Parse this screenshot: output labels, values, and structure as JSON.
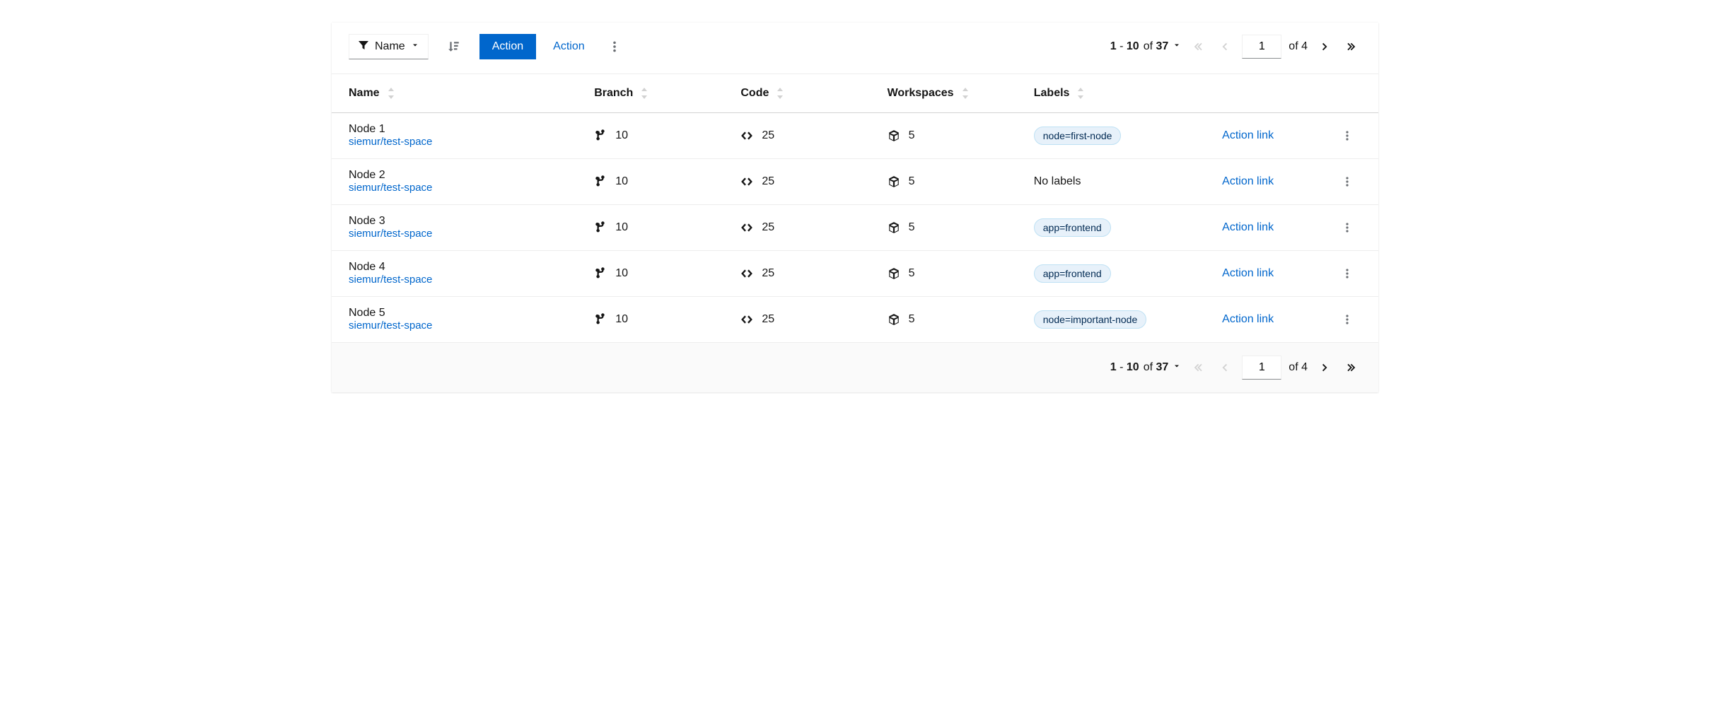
{
  "toolbar": {
    "filter_label": "Name",
    "primary_action": "Action",
    "secondary_action": "Action"
  },
  "pagination": {
    "range_start": "1",
    "range_end": "10",
    "total_items": "37",
    "of_label": "of",
    "page_value": "1",
    "total_pages": "4",
    "dash": " - "
  },
  "columns": {
    "name": "Name",
    "branch": "Branch",
    "code": "Code",
    "workspaces": "Workspaces",
    "labels": "Labels"
  },
  "table": {
    "action_link_label": "Action link",
    "no_labels_text": "No labels",
    "rows": [
      {
        "name": "Node 1",
        "sub": "siemur/test-space",
        "branch": "10",
        "code": "25",
        "workspaces": "5",
        "label": "node=first-node"
      },
      {
        "name": "Node 2",
        "sub": "siemur/test-space",
        "branch": "10",
        "code": "25",
        "workspaces": "5",
        "label": ""
      },
      {
        "name": "Node 3",
        "sub": "siemur/test-space",
        "branch": "10",
        "code": "25",
        "workspaces": "5",
        "label": "app=frontend"
      },
      {
        "name": "Node 4",
        "sub": "siemur/test-space",
        "branch": "10",
        "code": "25",
        "workspaces": "5",
        "label": "app=frontend"
      },
      {
        "name": "Node 5",
        "sub": "siemur/test-space",
        "branch": "10",
        "code": "25",
        "workspaces": "5",
        "label": "node=important-node"
      }
    ]
  }
}
